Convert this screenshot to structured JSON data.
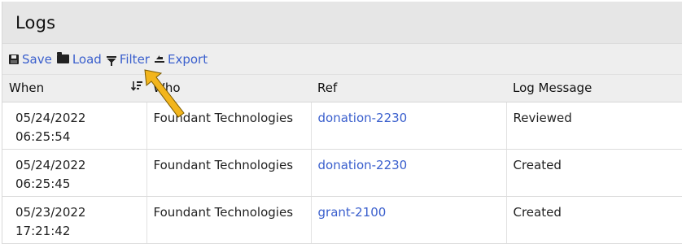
{
  "header": {
    "title": "Logs"
  },
  "toolbar": {
    "save_label": "Save",
    "load_label": "Load",
    "filter_label": "Filter",
    "export_label": "Export"
  },
  "table": {
    "columns": [
      "When",
      "Who",
      "Ref",
      "Log Message"
    ],
    "rows": [
      {
        "when": "05/24/2022 06:25:54",
        "who": "Foundant Technologies",
        "ref": "donation-2230",
        "message": "Reviewed"
      },
      {
        "when": "05/24/2022 06:25:45",
        "who": "Foundant Technologies",
        "ref": "donation-2230",
        "message": "Created"
      },
      {
        "when": "05/23/2022 17:21:42",
        "who": "Foundant Technologies",
        "ref": "grant-2100",
        "message": "Created"
      }
    ]
  },
  "colors": {
    "link": "#3a5fcd",
    "annotation_arrow": "#f2b51c"
  },
  "icons": [
    "save-icon",
    "folder-open-icon",
    "filter-icon",
    "export-icon",
    "sort-descending-icon",
    "pointer-arrow-annotation"
  ]
}
